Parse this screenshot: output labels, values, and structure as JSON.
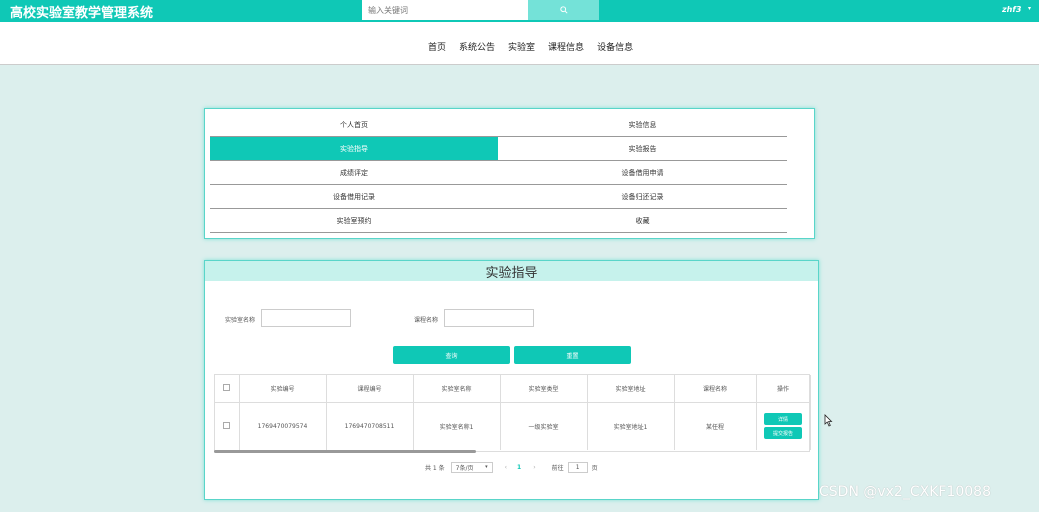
{
  "header": {
    "app_title": "高校实验室教学管理系统",
    "search_placeholder": "输入关键词",
    "user_name": "zhf3",
    "user_caret": "▾"
  },
  "nav": {
    "items": [
      "首页",
      "系统公告",
      "实验室",
      "课程信息",
      "设备信息"
    ]
  },
  "menu": {
    "items": [
      {
        "label": "个人首页",
        "active": false
      },
      {
        "label": "实验信息",
        "active": false
      },
      {
        "label": "实验指导",
        "active": true
      },
      {
        "label": "实验报告",
        "active": false
      },
      {
        "label": "成绩评定",
        "active": false
      },
      {
        "label": "设备借用申请",
        "active": false
      },
      {
        "label": "设备借用记录",
        "active": false
      },
      {
        "label": "设备归还记录",
        "active": false
      },
      {
        "label": "实验室预约",
        "active": false
      },
      {
        "label": "收藏",
        "active": false
      }
    ]
  },
  "panel": {
    "title": "实验指导",
    "filters": {
      "lab_name_label": "实验室名称",
      "course_name_label": "课程名称"
    },
    "query_button": "查询",
    "reset_button": "重置"
  },
  "table": {
    "columns": [
      "",
      "实验编号",
      "课程编号",
      "实验室名称",
      "实验室类型",
      "实验室地址",
      "课程名称",
      "操作"
    ],
    "rows": [
      {
        "experiment_no": "1769470079574",
        "course_no": "1769470708511",
        "lab_name": "实验室名称1",
        "lab_type": "一级实验室",
        "lab_address": "实验室地址1",
        "course_name": "某任程",
        "actions": [
          "详情",
          "提交报告"
        ]
      }
    ]
  },
  "pagination": {
    "total": "共 1 条",
    "page_size": "7条/页",
    "prev": "‹",
    "current": "1",
    "next": "›",
    "goto_label": "前往",
    "goto_value": "1",
    "page_suffix": "页"
  },
  "watermark": "CSDN @vx2_CXKF10088",
  "colors": {
    "accent": "#0fc8b6",
    "page_bg": "#dcefed",
    "panel_header_bg": "#c6f2ec"
  }
}
